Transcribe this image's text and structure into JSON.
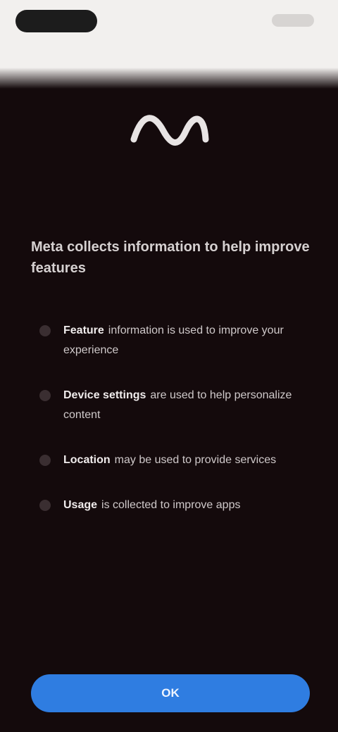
{
  "colors": {
    "background": "#140a0c",
    "topbar": "#f2f0ee",
    "accent": "#2f7de1",
    "text": "#e8e4e4"
  },
  "intro": {
    "text": "Meta collects information to help improve features"
  },
  "features": [
    {
      "icon": "bullet-dot",
      "title": "Feature",
      "desc": "information is used to improve your experience"
    },
    {
      "icon": "bullet-dot",
      "title": "Device settings",
      "desc": "are used to help personalize content"
    },
    {
      "icon": "bullet-dot",
      "title": "Location",
      "desc": "may be used to provide services"
    },
    {
      "icon": "bullet-dot",
      "title": "Usage",
      "desc": "is collected to improve apps"
    }
  ],
  "cta": {
    "label": "OK"
  }
}
